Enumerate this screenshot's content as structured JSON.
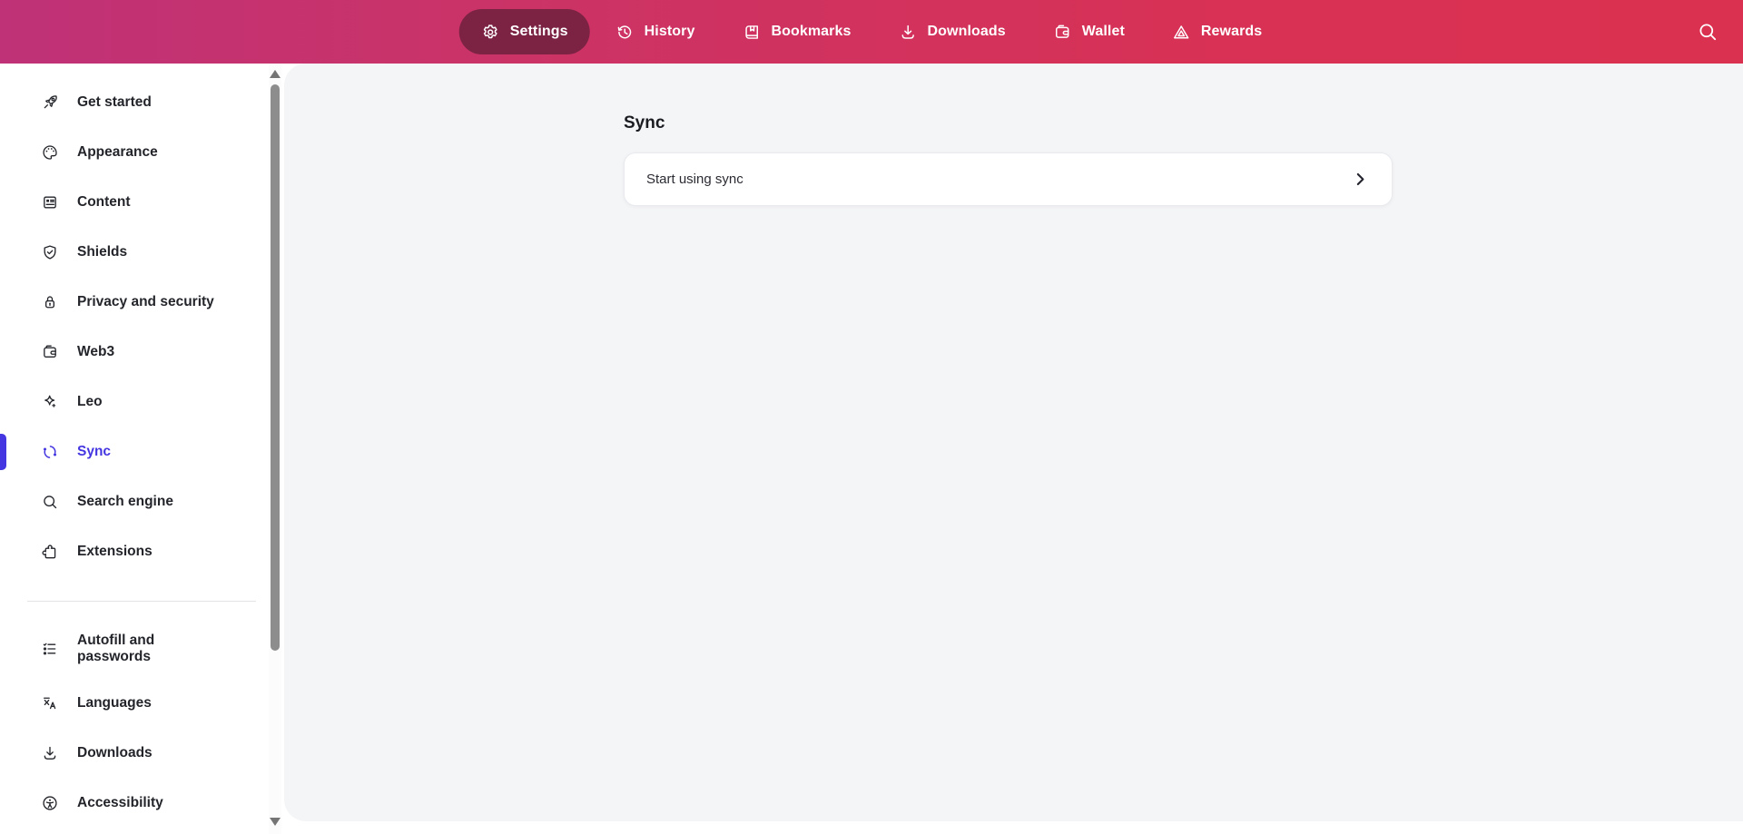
{
  "header": {
    "nav": [
      {
        "label": "Settings",
        "icon": "gear-icon",
        "active": true
      },
      {
        "label": "History",
        "icon": "history-clock-icon",
        "active": false
      },
      {
        "label": "Bookmarks",
        "icon": "bookmarks-book-icon",
        "active": false
      },
      {
        "label": "Downloads",
        "icon": "download-icon",
        "active": false
      },
      {
        "label": "Wallet",
        "icon": "wallet-icon",
        "active": false
      },
      {
        "label": "Rewards",
        "icon": "bat-triangle-icon",
        "active": false
      }
    ],
    "search_icon": "search-icon",
    "colors": {
      "gradient_left": "#bf3277",
      "gradient_right": "#db3150",
      "active_pill": "#7c2344"
    }
  },
  "sidebar": {
    "items": [
      {
        "label": "Get started",
        "icon": "rocket-icon"
      },
      {
        "label": "Appearance",
        "icon": "palette-icon"
      },
      {
        "label": "Content",
        "icon": "content-window-icon"
      },
      {
        "label": "Shields",
        "icon": "shield-check-icon"
      },
      {
        "label": "Privacy and security",
        "icon": "lock-icon"
      },
      {
        "label": "Web3",
        "icon": "wallet-icon"
      },
      {
        "label": "Leo",
        "icon": "sparkle-icon"
      },
      {
        "label": "Sync",
        "icon": "sync-icon",
        "active": true
      },
      {
        "label": "Search engine",
        "icon": "search-icon"
      },
      {
        "label": "Extensions",
        "icon": "puzzle-icon"
      },
      {
        "label": "Autofill and passwords",
        "icon": "checklist-icon"
      },
      {
        "label": "Languages",
        "icon": "translate-icon"
      },
      {
        "label": "Downloads",
        "icon": "download-icon"
      },
      {
        "label": "Accessibility",
        "icon": "accessibility-icon"
      }
    ],
    "active_color": "#4436e0"
  },
  "main": {
    "title": "Sync",
    "card": {
      "label": "Start using sync",
      "chevron_icon": "chevron-right-icon"
    },
    "background": "#f4f5f7"
  }
}
